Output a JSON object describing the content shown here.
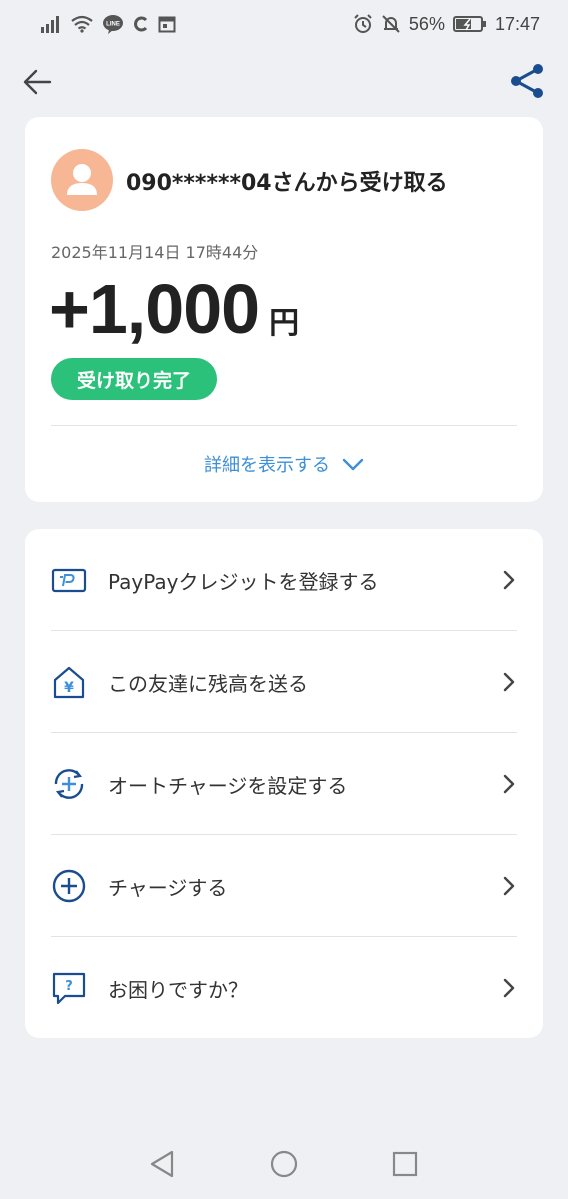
{
  "status_bar": {
    "battery": "56%",
    "time": "17:47",
    "line_badge": "LINE"
  },
  "transaction": {
    "title": "090******04さんから受け取る",
    "datetime": "2025年11月14日 17時44分",
    "amount": "+1,000",
    "currency": "円",
    "status": "受け取り完了",
    "details_label": "詳細を表示する"
  },
  "menu": {
    "items": [
      {
        "label": "PayPayクレジットを登録する",
        "icon": "credit-card-icon"
      },
      {
        "label": "この友達に残高を送る",
        "icon": "send-yen-icon"
      },
      {
        "label": "オートチャージを設定する",
        "icon": "auto-charge-icon"
      },
      {
        "label": "チャージする",
        "icon": "charge-plus-icon"
      },
      {
        "label": "お困りですか？",
        "icon": "help-chat-icon"
      }
    ]
  },
  "colors": {
    "accent_blue": "#1a4d8f",
    "link_blue": "#3d8fd8",
    "success_green": "#2cc17a",
    "avatar_bg": "#f7b795",
    "background": "#eff0f4"
  }
}
